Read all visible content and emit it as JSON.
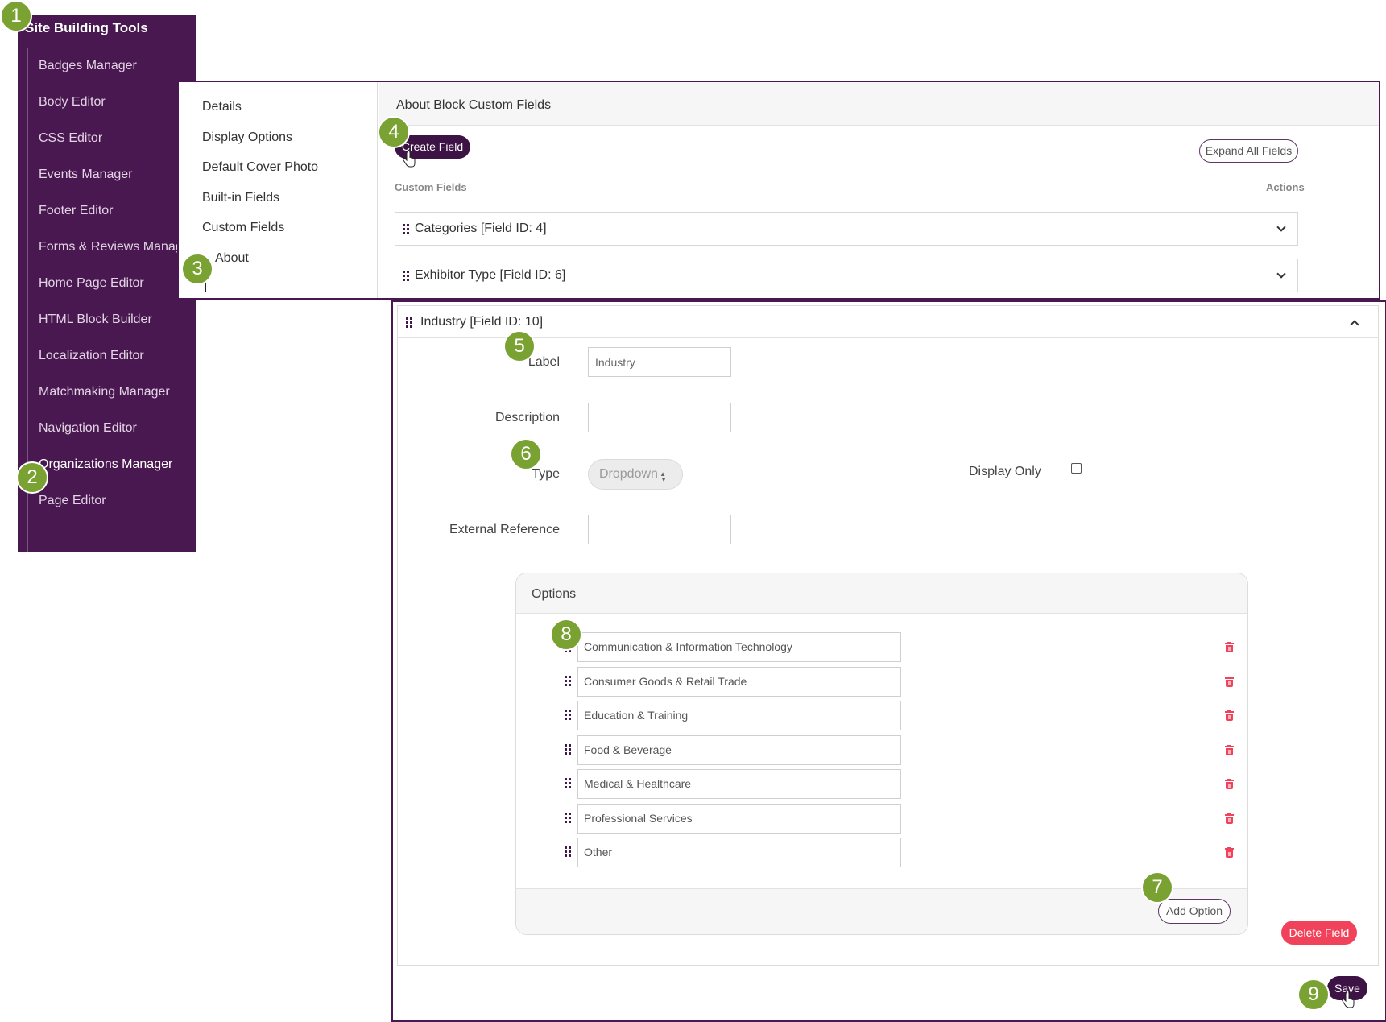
{
  "sidebar": {
    "title": "Site Building Tools",
    "items": [
      {
        "label": "Badges Manager"
      },
      {
        "label": "Body Editor"
      },
      {
        "label": "CSS Editor"
      },
      {
        "label": "Events Manager"
      },
      {
        "label": "Footer Editor"
      },
      {
        "label": "Forms & Reviews Manag"
      },
      {
        "label": "Home Page Editor"
      },
      {
        "label": "HTML Block Builder"
      },
      {
        "label": "Localization Editor"
      },
      {
        "label": "Matchmaking Manager"
      },
      {
        "label": "Navigation Editor"
      },
      {
        "label": "Organizations Manager",
        "active": true
      },
      {
        "label": "Page Editor"
      }
    ]
  },
  "details_nav": {
    "items": [
      {
        "label": "Details"
      },
      {
        "label": "Display Options"
      },
      {
        "label": "Default Cover Photo"
      },
      {
        "label": "Built-in Fields"
      },
      {
        "label": "Custom Fields"
      },
      {
        "label": "About",
        "active": true
      }
    ]
  },
  "block": {
    "header": "About Block Custom Fields",
    "create_field_label": "Create Field",
    "expand_all_label": "Expand All Fields",
    "custom_fields_label": "Custom Fields",
    "actions_label": "Actions",
    "fields": [
      {
        "label": "Categories [Field ID: 4]"
      },
      {
        "label": "Exhibitor Type [Field ID: 6]"
      }
    ]
  },
  "field": {
    "header": "Industry [Field ID: 10]",
    "label_label": "Label",
    "label_value": "Industry",
    "description_label": "Description",
    "description_value": "",
    "type_label": "Type",
    "type_value": "Dropdown",
    "display_only_label": "Display Only",
    "display_only_checked": false,
    "external_reference_label": "External Reference",
    "external_reference_value": "",
    "options_title": "Options",
    "options": [
      "Communication & Information Technology",
      "Consumer Goods & Retail Trade",
      "Education & Training",
      "Food & Beverage",
      "Medical & Healthcare",
      "Professional Services",
      "Other"
    ],
    "add_option_label": "Add Option",
    "delete_field_label": "Delete Field",
    "save_label": "Save"
  },
  "callouts": [
    "1",
    "2",
    "3",
    "4",
    "5",
    "6",
    "7",
    "8",
    "9"
  ],
  "colors": {
    "sidebar_bg": "#4a1850",
    "primary_button": "#3d1244",
    "danger": "#f0425a",
    "callout": "#7aa232"
  },
  "icons": {
    "drag_handle": "grip-vertical-icon",
    "expand": "chevron-down-icon",
    "collapse": "chevron-up-icon",
    "delete": "trash-icon",
    "select": "sort-arrows-icon",
    "pointer": "hand-pointer-icon"
  }
}
